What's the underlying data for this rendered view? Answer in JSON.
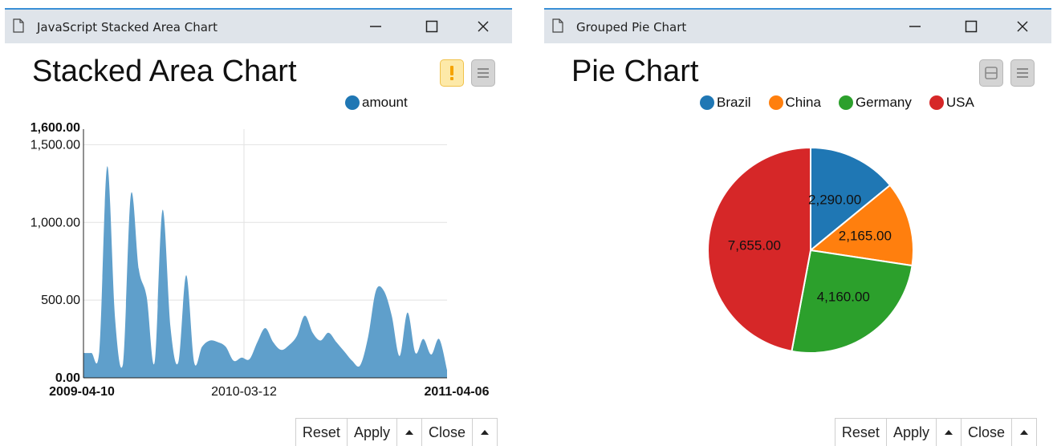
{
  "left_window": {
    "title": "JavaScript Stacked Area Chart",
    "chart_title": "Stacked Area Chart",
    "legend": "amount",
    "buttons": {
      "reset": "Reset",
      "apply": "Apply",
      "close": "Close"
    }
  },
  "right_window": {
    "title": "Grouped Pie Chart",
    "chart_title": "Pie Chart",
    "buttons": {
      "reset": "Reset",
      "apply": "Apply",
      "close": "Close"
    }
  },
  "colors": {
    "area": "#5f9fcb",
    "brazil": "#1f77b4",
    "china": "#ff7f0e",
    "germany": "#2ca02c",
    "usa": "#d62728",
    "titlebar_accent": "#3a8fd6"
  },
  "icons": [
    "document-icon",
    "minimize-icon",
    "maximize-icon",
    "close-icon",
    "warning-icon",
    "menu-icon",
    "collapse-icon",
    "arrow-up-icon"
  ],
  "chart_data": [
    {
      "type": "area",
      "title": "Stacked Area Chart",
      "series": [
        {
          "name": "amount",
          "values": [
            160,
            160,
            170,
            1360,
            380,
            90,
            1180,
            700,
            520,
            100,
            1080,
            330,
            100,
            660,
            100,
            200,
            240,
            230,
            200,
            110,
            130,
            120,
            230,
            320,
            230,
            180,
            210,
            270,
            400,
            290,
            240,
            290,
            230,
            170,
            110,
            80,
            260,
            560,
            560,
            400,
            140,
            420,
            160,
            250,
            150,
            250,
            50
          ]
        }
      ],
      "x_first": "2009-04-10",
      "x_ticks": [
        "2009-04-10",
        "2010-03-12",
        "2011-04-06"
      ],
      "y_ticks": [
        "0.00",
        "500.00",
        "1,000.00",
        "1,500.00",
        "1,600.00"
      ],
      "ylim": [
        0,
        1600
      ],
      "grid": true,
      "legend": "top-right"
    },
    {
      "type": "pie",
      "title": "Pie Chart",
      "slices": [
        {
          "label": "Brazil",
          "value": 2290,
          "text": "2,290.00",
          "color": "#1f77b4"
        },
        {
          "label": "China",
          "value": 2165,
          "text": "2,165.00",
          "color": "#ff7f0e"
        },
        {
          "label": "Germany",
          "value": 4160,
          "text": "4,160.00",
          "color": "#2ca02c"
        },
        {
          "label": "USA",
          "value": 7655,
          "text": "7,655.00",
          "color": "#d62728"
        }
      ],
      "legend": "top"
    }
  ]
}
